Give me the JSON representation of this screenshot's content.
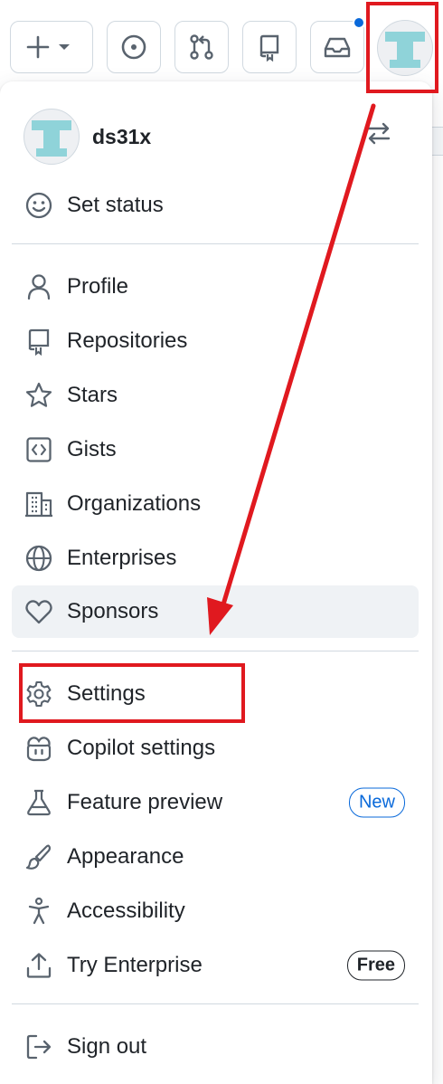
{
  "header": {
    "buttons": [
      {
        "name": "create-new-button",
        "icon": "plus-icon"
      },
      {
        "name": "issues-button",
        "icon": "issue-opened-icon"
      },
      {
        "name": "pull-requests-button",
        "icon": "git-pull-request-icon"
      },
      {
        "name": "repositories-button",
        "icon": "repo-icon"
      },
      {
        "name": "inbox-button",
        "icon": "inbox-icon"
      }
    ],
    "notification_color": "#0969da"
  },
  "user": {
    "username": "ds31x",
    "avatar_letter_color": "#8fd3d9"
  },
  "menu": {
    "set_status": "Set status",
    "profile": "Profile",
    "repositories": "Repositories",
    "stars": "Stars",
    "gists": "Gists",
    "organizations": "Organizations",
    "enterprises": "Enterprises",
    "sponsors": "Sponsors",
    "settings": "Settings",
    "copilot_settings": "Copilot settings",
    "feature_preview": "Feature preview",
    "feature_preview_badge": "New",
    "appearance": "Appearance",
    "accessibility": "Accessibility",
    "try_enterprise": "Try Enterprise",
    "try_enterprise_badge": "Free",
    "sign_out": "Sign out"
  },
  "annotation_color": "#e0191f"
}
